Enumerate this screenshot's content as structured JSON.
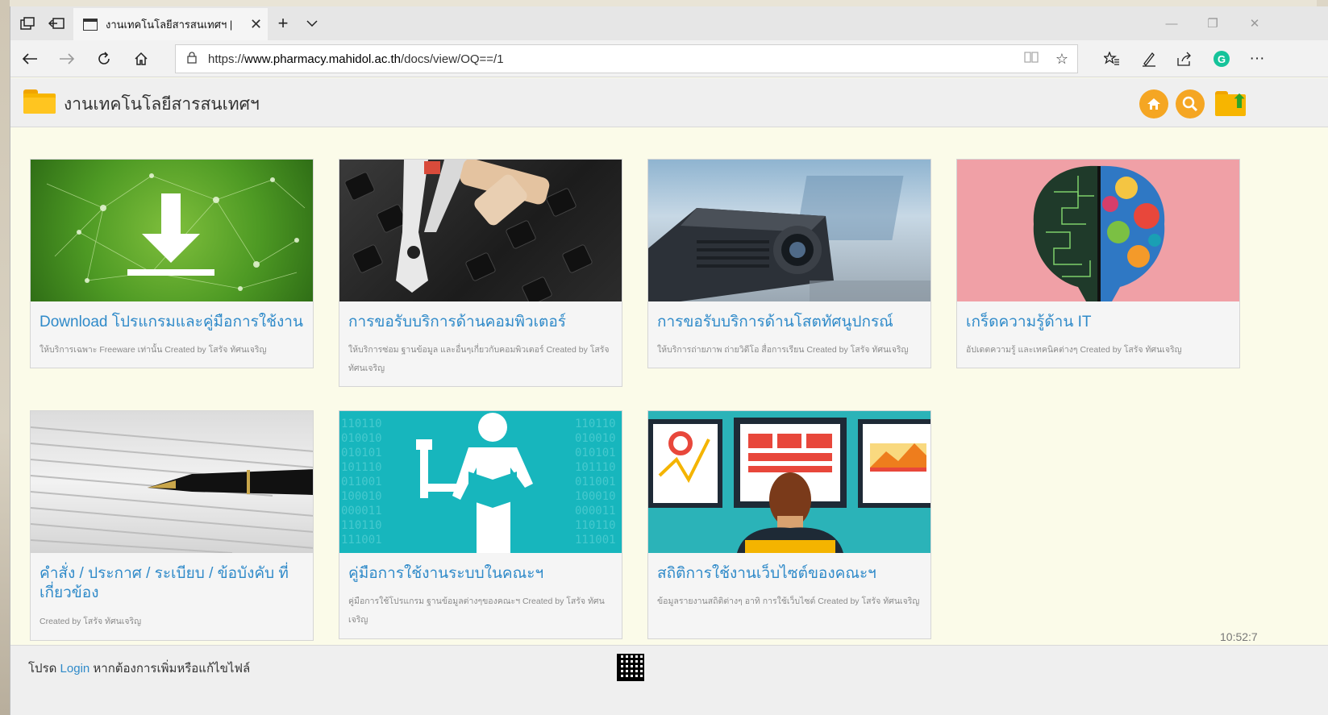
{
  "browser": {
    "tab_title": "งานเทคโนโลยีสารสนเทศฯ |",
    "url_prefix": "https://",
    "url_domain": "www.pharmacy.mahidol.ac.th",
    "url_path": "/docs/view/OQ==/1"
  },
  "site": {
    "title": "งานเทคโนโลยีสารสนเทศฯ"
  },
  "cards": [
    {
      "title": "Download โปรแกรมและคู่มือการใช้งาน",
      "desc": "ให้บริการเฉพาะ Freeware เท่านั้น Created by โสรัจ ทัศนเจริญ"
    },
    {
      "title": "การขอรับบริการด้านคอมพิวเตอร์",
      "desc": "ให้บริการซ่อม ฐานข้อมูล และอื่นๆเกี่ยวกับคอมพิวเตอร์ Created by โสรัจ ทัศนเจริญ"
    },
    {
      "title": "การขอรับบริการด้านโสตทัศนูปกรณ์",
      "desc": "ให้บริการถ่ายภาพ ถ่ายวิดีโอ สื่อการเรียน Created by โสรัจ ทัศนเจริญ"
    },
    {
      "title": "เกร็ดความรู้ด้าน IT",
      "desc": "อัปเดตความรู้ และเทคนิคต่างๆ Created by โสรัจ ทัศนเจริญ"
    },
    {
      "title": "คำสั่ง / ประกาศ / ระเบียบ / ข้อบังคับ ที่เกี่ยวข้อง",
      "desc": "Created by โสรัจ ทัศนเจริญ"
    },
    {
      "title": "คู่มือการใช้งานระบบในคณะฯ",
      "desc": "คู่มือการใช้โปรแกรม ฐานข้อมูลต่างๆของคณะฯ Created by โสรัจ ทัศนเจริญ"
    },
    {
      "title": "สถิติการใช้งานเว็บไซต์ของคณะฯ",
      "desc": "ข้อมูลรายงานสถิติต่างๆ อาทิ การใช้เว็บไซต์ Created by โสรัจ ทัศนเจริญ"
    }
  ],
  "footer": {
    "before": "โปรด ",
    "login": "Login",
    "after": " หากต้องการเพิ่มหรือแก้ไขไฟล์"
  },
  "clock": "10:52:7"
}
